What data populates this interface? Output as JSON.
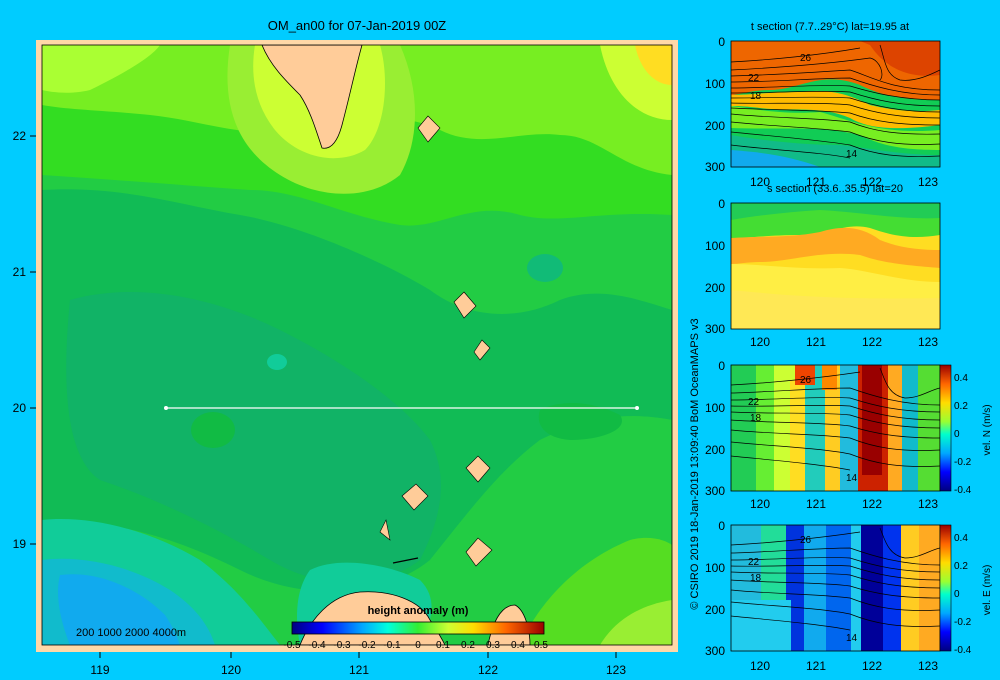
{
  "title": "OM_an00 for 07-Jan-2019 00Z",
  "main_map": {
    "lon_ticks": [
      "119",
      "120",
      "121",
      "122",
      "123"
    ],
    "lat_ticks": [
      "22",
      "21",
      "20",
      "19"
    ],
    "depth_legend": "200  1000  2000  4000m",
    "colorbar_title": "height anomaly  (m)",
    "colorbar_ticks": [
      "-0.5",
      "-0.4",
      "-0.3",
      "-0.2",
      "-0.1",
      "0",
      "0.1",
      "0.2",
      "0.3",
      "0.4",
      "0.5"
    ],
    "section_line": {
      "lon_start": 119.5,
      "lon_end": 123.2,
      "lat": 20
    }
  },
  "panels": {
    "p1_title": "t section (7.7..29°C) lat=19.95 at",
    "p2_title": "s section (33.6..35.5) lat=20",
    "depth_ticks": [
      "0",
      "100",
      "200",
      "300"
    ],
    "lon_ticks": [
      "120",
      "121",
      "122",
      "123"
    ],
    "contour_labels_t": [
      "26",
      "22",
      "18",
      "14"
    ],
    "p3_colorbar_label": "vel. N  (m/s)",
    "p4_colorbar_label": "vel. E  (m/s)",
    "vel_ticks": [
      "0.4",
      "0.2",
      "0",
      "-0.2",
      "-0.4"
    ]
  },
  "credit": "© CSIRO 2019   18-Jan-2019 13:09:40 BoM OceanMAPS v3",
  "colors": {
    "background": "#00ccff",
    "land": "#ffcc99",
    "frame": "#ffd8a8"
  }
}
